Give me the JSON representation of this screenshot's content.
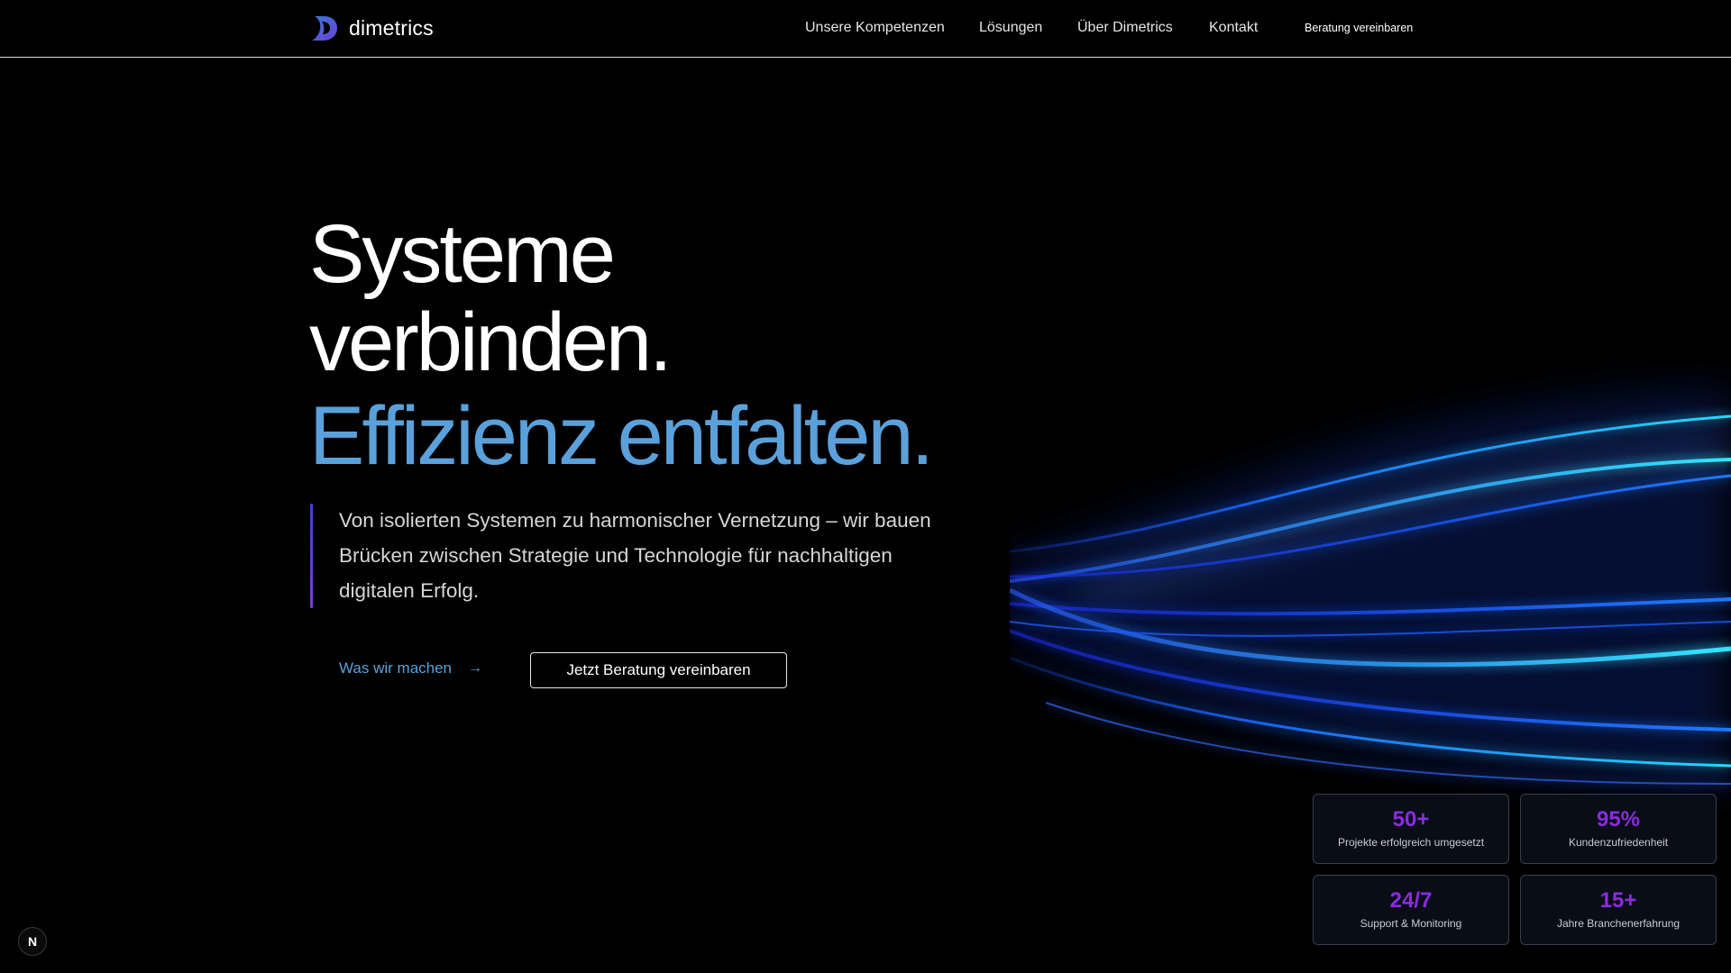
{
  "header": {
    "brand": "dimetrics",
    "nav": [
      "Unsere Kompetenzen",
      "Lösungen",
      "Über Dimetrics",
      "Kontakt"
    ],
    "cta": "Beratung vereinbaren"
  },
  "hero": {
    "line1": "Systeme",
    "line2": "verbinden.",
    "line3": "Effizienz entfalten.",
    "lead": "Von isolierten Systemen zu harmonischer Vernetzung – wir bauen Brücken zwischen Strategie und Technologie für nachhaltigen digitalen Erfolg.",
    "secondary_button": "Was wir machen",
    "primary_button": "Jetzt Beratung vereinbaren"
  },
  "stats": [
    {
      "value": "50+",
      "label": "Projekte erfolgreich umgesetzt"
    },
    {
      "value": "95%",
      "label": "Kundenzufriedenheit"
    },
    {
      "value": "24/7",
      "label": "Support & Monitoring"
    },
    {
      "value": "15+",
      "label": "Jahre Branchenerfahrung"
    }
  ],
  "badge": "N",
  "colors": {
    "accent_blue": "#5aa1db",
    "stat_purple": "#8a2be2",
    "background": "#000000"
  },
  "icons": {
    "logo": "dimetrics-logo-icon",
    "arrow": "arrow-right-icon"
  }
}
